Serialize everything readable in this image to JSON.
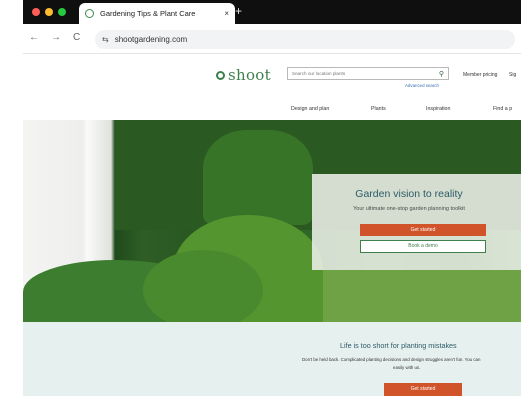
{
  "browser": {
    "traffic_lights": {
      "close": "#ff5f57",
      "minimize": "#febc2e",
      "maximize": "#28c840"
    },
    "tab": {
      "title": "Gardening Tips & Plant Care",
      "close_glyph": "×"
    },
    "new_tab_glyph": "+",
    "nav": {
      "back": "←",
      "forward": "→",
      "reload": "C"
    },
    "site_info_glyph": "⇆",
    "url": "shootgardening.com"
  },
  "site": {
    "brand": "shoot",
    "brand_color": "#3f7f4b",
    "search_placeholder": "Search our location plants",
    "advanced_search": "Advanced search",
    "header_links": [
      "Member pricing",
      "Sig"
    ],
    "nav_items": [
      "Design and plan",
      "Plants",
      "Inspiration",
      "Find a p"
    ],
    "hero": {
      "title": "Garden vision to reality",
      "subtitle": "Your ultimate one-stop garden planning toolkit",
      "primary_button": "Get started",
      "secondary_button": "Book a demo",
      "accent": "#d0532a"
    },
    "intro": {
      "title": "Life is too short for planting mistakes",
      "text_line1": "Don't be held back. Complicated planting decisions and design struggles aren't fun. You can",
      "text_line2": "easily with us.",
      "button": "Get started",
      "background": "#e6f0ee"
    }
  }
}
